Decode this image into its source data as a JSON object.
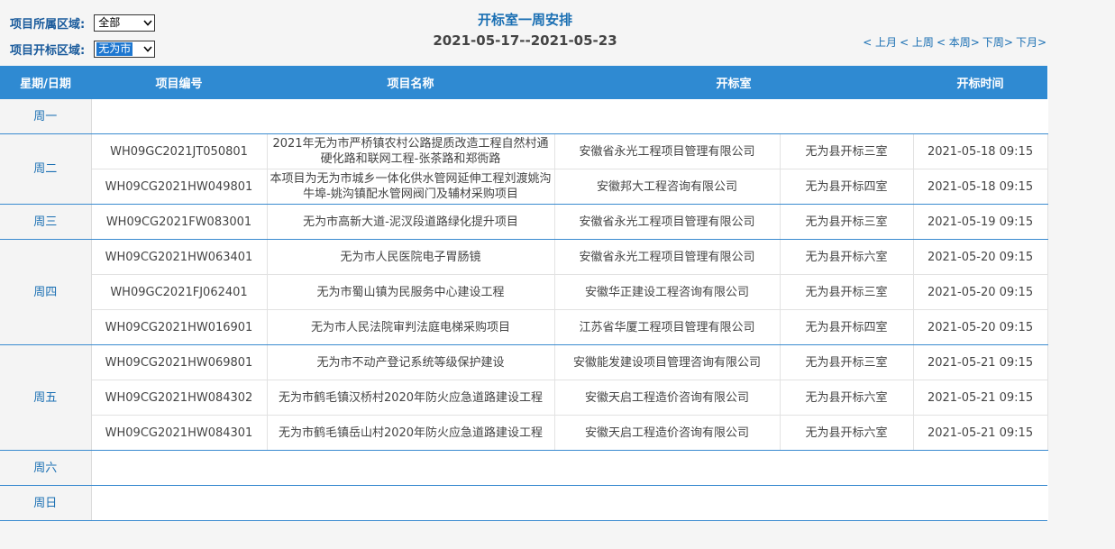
{
  "filters": {
    "region_label": "项目所属区域:",
    "region_value": "全部",
    "open_region_label": "项目开标区域:",
    "open_region_value": "无为市"
  },
  "header": {
    "title": "开标室一周安排",
    "date_range": "2021-05-17--2021-05-23"
  },
  "nav": {
    "prev_month": "< 上月",
    "prev_week": "< 上周",
    "this_week": "< 本周>",
    "next_week": "下周>",
    "next_month": "下月>"
  },
  "table": {
    "columns": [
      "星期/日期",
      "项目编号",
      "项目名称",
      "开标室",
      "开标时间"
    ],
    "days": [
      {
        "day": "周一",
        "rows": []
      },
      {
        "day": "周二",
        "rows": [
          {
            "code": "WH09GC2021JT050801",
            "name": "2021年无为市严桥镇农村公路提质改造工程自然村通硬化路和联网工程-张茶路和郑衖路",
            "agency": "安徽省永光工程项目管理有限公司",
            "room": "无为县开标三室",
            "time": "2021-05-18 09:15"
          },
          {
            "code": "WH09CG2021HW049801",
            "name": "本项目为无为市城乡一体化供水管网延伸工程刘渡姚沟牛埠-姚沟镇配水管网阀门及辅材采购项目",
            "agency": "安徽邦大工程咨询有限公司",
            "room": "无为县开标四室",
            "time": "2021-05-18 09:15"
          }
        ]
      },
      {
        "day": "周三",
        "rows": [
          {
            "code": "WH09CG2021FW083001",
            "name": "无为市高新大道-泥汊段道路绿化提升项目",
            "agency": "安徽省永光工程项目管理有限公司",
            "room": "无为县开标三室",
            "time": "2021-05-19 09:15"
          }
        ]
      },
      {
        "day": "周四",
        "rows": [
          {
            "code": "WH09CG2021HW063401",
            "name": "无为市人民医院电子胃肠镜",
            "agency": "安徽省永光工程项目管理有限公司",
            "room": "无为县开标六室",
            "time": "2021-05-20 09:15"
          },
          {
            "code": "WH09GC2021FJ062401",
            "name": "无为市蜀山镇为民服务中心建设工程",
            "agency": "安徽华正建设工程咨询有限公司",
            "room": "无为县开标三室",
            "time": "2021-05-20 09:15"
          },
          {
            "code": "WH09CG2021HW016901",
            "name": "无为市人民法院审判法庭电梯采购项目",
            "agency": "江苏省华厦工程项目管理有限公司",
            "room": "无为县开标四室",
            "time": "2021-05-20 09:15"
          }
        ]
      },
      {
        "day": "周五",
        "rows": [
          {
            "code": "WH09CG2021HW069801",
            "name": "无为市不动产登记系统等级保护建设",
            "agency": "安徽能发建设项目管理咨询有限公司",
            "room": "无为县开标三室",
            "time": "2021-05-21 09:15"
          },
          {
            "code": "WH09CG2021HW084302",
            "name": "无为市鹤毛镇汉桥村2020年防火应急道路建设工程",
            "agency": "安徽天启工程造价咨询有限公司",
            "room": "无为县开标六室",
            "time": "2021-05-21 09:15"
          },
          {
            "code": "WH09CG2021HW084301",
            "name": "无为市鹤毛镇岳山村2020年防火应急道路建设工程",
            "agency": "安徽天启工程造价咨询有限公司",
            "room": "无为县开标六室",
            "time": "2021-05-21 09:15"
          }
        ]
      },
      {
        "day": "周六",
        "rows": []
      },
      {
        "day": "周日",
        "rows": []
      }
    ]
  }
}
